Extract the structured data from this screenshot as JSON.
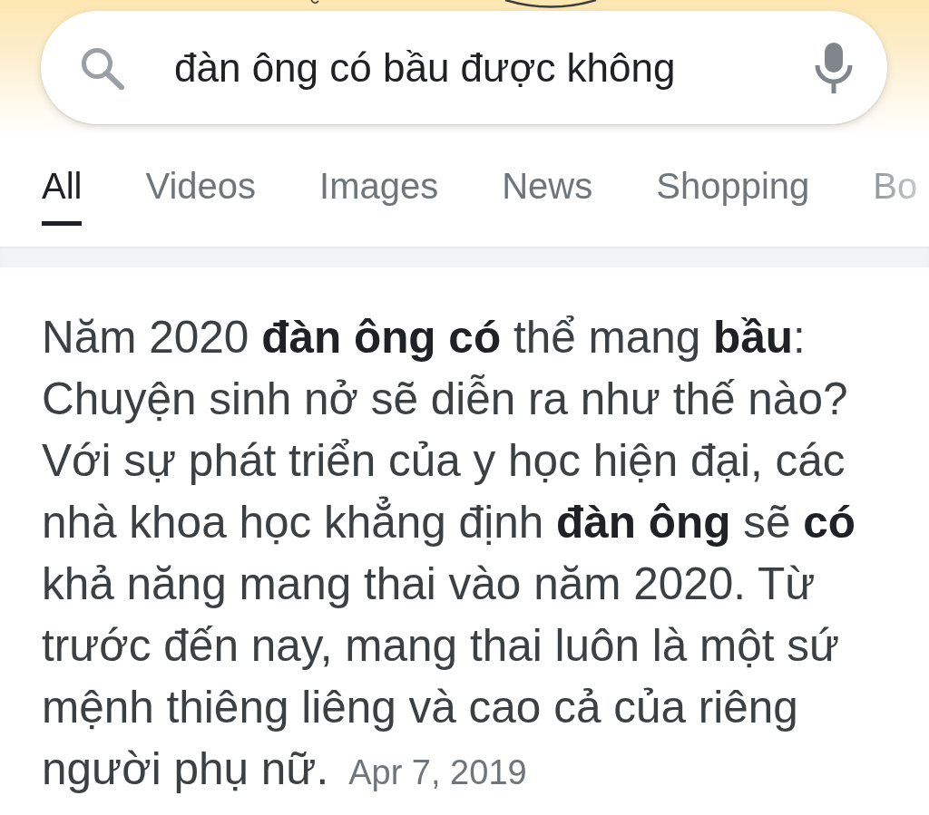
{
  "search": {
    "value": "đàn ông có bầu được không"
  },
  "tabs": [
    {
      "label": "All",
      "selected": true
    },
    {
      "label": "Videos",
      "selected": false
    },
    {
      "label": "Images",
      "selected": false
    },
    {
      "label": "News",
      "selected": false
    },
    {
      "label": "Shopping",
      "selected": false
    },
    {
      "label": "Bo",
      "selected": false
    }
  ],
  "result": {
    "snippet": "Năm 2020 **đàn ông có** thể mang **bầu**: Chuyện sinh nở sẽ diễn ra như thế nào? Với sự phát triển của y học hiện đại, các nhà khoa học khẳng định **đàn ông** sẽ **có** khả năng mang thai vào năm 2020. Từ trước đến nay, mang thai luôn là một sứ mệnh thiêng liêng và cao cả của riêng người phụ nữ.",
    "date": "Apr 7, 2019"
  }
}
